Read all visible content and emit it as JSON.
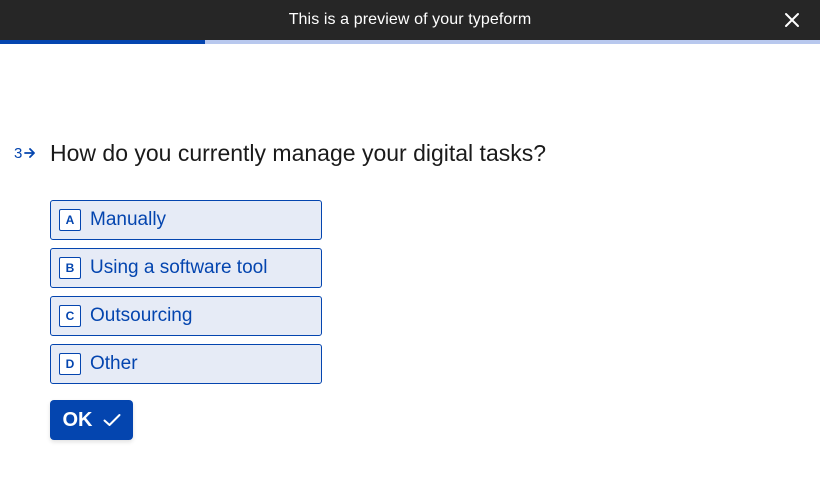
{
  "header": {
    "title": "This is a preview of your typeform",
    "close_icon": "close-icon"
  },
  "progress": {
    "fraction": 0.25,
    "color": "#0445AF",
    "track_color": "#b8c8ee"
  },
  "question": {
    "number": "3",
    "arrow_icon": "arrow-right-icon",
    "text": "How do you currently manage your digital tasks?"
  },
  "choices": [
    {
      "key": "A",
      "label": "Manually"
    },
    {
      "key": "B",
      "label": "Using a software tool"
    },
    {
      "key": "C",
      "label": "Outsourcing"
    },
    {
      "key": "D",
      "label": "Other"
    }
  ],
  "ok_button": {
    "label": "OK",
    "icon": "checkmark-icon"
  },
  "colors": {
    "accent": "#0445AF",
    "choice_background": "#e6ebf6",
    "header_background": "#262626"
  }
}
